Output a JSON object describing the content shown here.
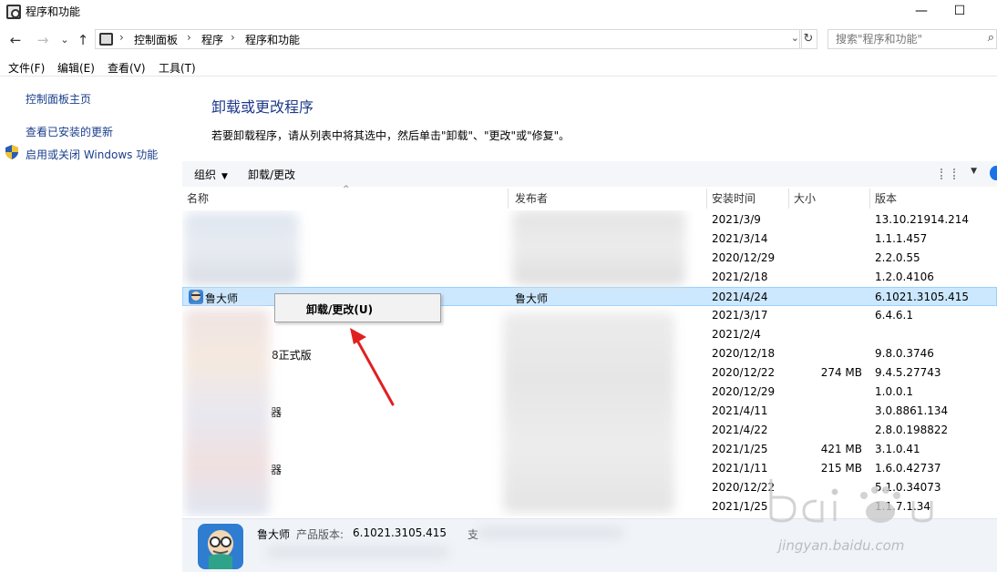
{
  "window": {
    "title": "程序和功能",
    "minimize": "—",
    "maximize": "☐"
  },
  "address": {
    "breadcrumbs": [
      "控制面板",
      "程序",
      "程序和功能"
    ],
    "separator": "›",
    "search_placeholder": "搜索\"程序和功能\""
  },
  "menu": [
    "文件(F)",
    "编辑(E)",
    "查看(V)",
    "工具(T)"
  ],
  "sidebar": {
    "items": [
      {
        "label": "控制面板主页"
      },
      {
        "label": "查看已安装的更新"
      },
      {
        "label": "启用或关闭 Windows 功能"
      }
    ]
  },
  "main": {
    "heading": "卸载或更改程序",
    "instruction": "若要卸载程序，请从列表中将其选中，然后单击\"卸载\"、\"更改\"或\"修复\"。"
  },
  "toolbar": {
    "organize": "组织",
    "uninstall_change": "卸载/更改"
  },
  "columns": [
    "名称",
    "发布者",
    "安装时间",
    "大小",
    "版本"
  ],
  "rows": [
    {
      "name": "",
      "publisher": "",
      "date": "2021/3/9",
      "size": "",
      "version": "13.10.21914.214"
    },
    {
      "name": "",
      "publisher": "",
      "date": "2021/3/14",
      "size": "",
      "version": "1.1.1.457"
    },
    {
      "name": "",
      "publisher": "",
      "date": "2020/12/29",
      "size": "",
      "version": "2.2.0.55"
    },
    {
      "name": "",
      "publisher": "",
      "date": "2021/2/18",
      "size": "",
      "version": "1.2.0.4106"
    },
    {
      "name": "鲁大师",
      "publisher": "鲁大师",
      "date": "2021/4/24",
      "size": "",
      "version": "6.1021.3105.415",
      "selected": true
    },
    {
      "name": "",
      "publisher": "",
      "date": "2021/3/17",
      "size": "",
      "version": "6.4.6.1"
    },
    {
      "name": "",
      "publisher": "",
      "date": "2021/2/4",
      "size": "",
      "version": ""
    },
    {
      "name": "8正式版",
      "publisher": "",
      "date": "2020/12/18",
      "size": "",
      "version": "9.8.0.3746"
    },
    {
      "name": "",
      "publisher": "",
      "date": "2020/12/22",
      "size": "274 MB",
      "version": "9.4.5.27743"
    },
    {
      "name": "",
      "publisher": "",
      "date": "2020/12/29",
      "size": "",
      "version": "1.0.0.1"
    },
    {
      "name": "器",
      "publisher": "",
      "date": "2021/4/11",
      "size": "",
      "version": "3.0.8861.134"
    },
    {
      "name": "",
      "publisher": "",
      "date": "2021/4/22",
      "size": "",
      "version": "2.8.0.198822"
    },
    {
      "name": "",
      "publisher": "",
      "date": "2021/1/25",
      "size": "421 MB",
      "version": "3.1.0.41"
    },
    {
      "name": "器",
      "publisher": "",
      "date": "2021/1/11",
      "size": "215 MB",
      "version": "1.6.0.42737"
    },
    {
      "name": "",
      "publisher": "",
      "date": "2020/12/22",
      "size": "",
      "version": "5.1.0.34073"
    },
    {
      "name": "",
      "publisher": "",
      "date": "2021/1/25",
      "size": "",
      "version": "1.1.7.1.34"
    }
  ],
  "context_menu": {
    "item": "卸载/更改(U)"
  },
  "details": {
    "app_name": "鲁大师",
    "version_label": "产品版本:",
    "version_value": "6.1021.3105.415",
    "support_label": "支"
  },
  "watermark": {
    "text": "jingyan.baidu.com"
  },
  "colors": {
    "selected_row": "#cce8ff",
    "heading": "#1e3a8a",
    "link": "#1a3e8c",
    "arrow": "#e02020"
  },
  "icons": {
    "back": "←",
    "forward": "→",
    "recent": "⌄",
    "up": "↑",
    "refresh": "↻",
    "search": "⌕",
    "dropdown": "⌄",
    "caret": "▼"
  }
}
